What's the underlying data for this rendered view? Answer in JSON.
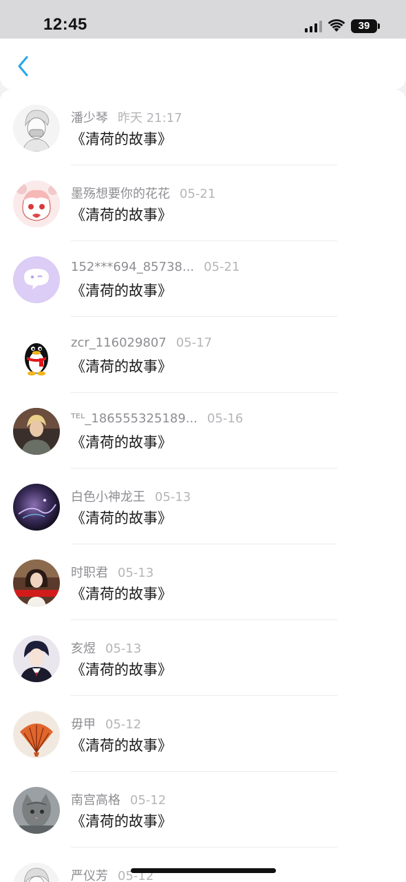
{
  "status": {
    "time": "12:45",
    "battery": "39"
  },
  "nav": {
    "back_icon": "chevron-left-icon",
    "accent": "#2fa6e8"
  },
  "items": [
    {
      "name": "潘少琴",
      "date": "昨天 21:17",
      "content": "《清荷的故事》",
      "avatar": "sketch-person"
    },
    {
      "name": "墨殇想要你的花花",
      "date": "05-21",
      "content": "《清荷的故事》",
      "avatar": "anime-girl"
    },
    {
      "name": "152***694_85738...",
      "date": "05-21",
      "content": "《清荷的故事》",
      "avatar": "purple-chat-bubble"
    },
    {
      "name": "zcr_116029807",
      "date": "05-17",
      "content": "《清荷的故事》",
      "avatar": "penguin"
    },
    {
      "name": "ᵀᴱᴸ_186555325189...",
      "date": "05-16",
      "content": "《清荷的故事》",
      "avatar": "blonde-man"
    },
    {
      "name": "白色小神龙王",
      "date": "05-13",
      "content": "《清荷的故事》",
      "avatar": "dark-dragon"
    },
    {
      "name": "时职君",
      "date": "05-13",
      "content": "《清荷的故事》",
      "avatar": "girl-red-banner"
    },
    {
      "name": "亥煜",
      "date": "05-13",
      "content": "《清荷的故事》",
      "avatar": "anime-boy"
    },
    {
      "name": "毋甲",
      "date": "05-12",
      "content": "《清荷的故事》",
      "avatar": "seashell"
    },
    {
      "name": "南宫高格",
      "date": "05-12",
      "content": "《清荷的故事》",
      "avatar": "cat"
    },
    {
      "name": "严仪芳",
      "date": "05-12",
      "content": "",
      "avatar": "sketch-partial"
    }
  ]
}
